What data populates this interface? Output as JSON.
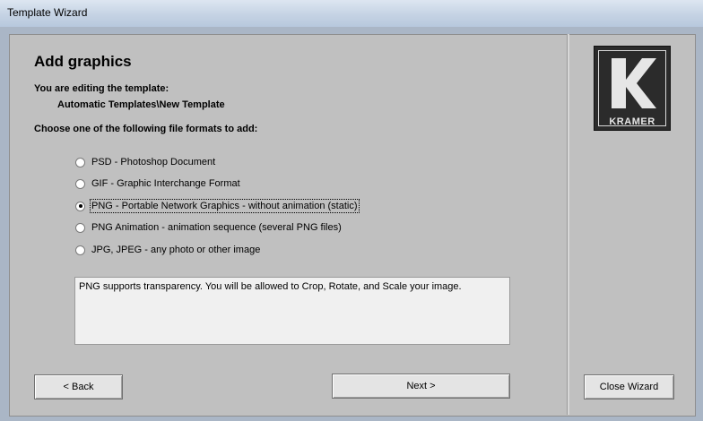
{
  "window": {
    "title": "Template Wizard"
  },
  "header": {
    "title": "Add graphics",
    "editing_label": "You are editing the template:",
    "template_path": "Automatic Templates\\New Template",
    "choose_label": "Choose one of the following file formats to add:"
  },
  "options": [
    {
      "label": "PSD - Photoshop Document",
      "selected": false
    },
    {
      "label": "GIF - Graphic Interchange Format",
      "selected": false
    },
    {
      "label": "PNG - Portable Network Graphics - without animation (static)",
      "selected": true
    },
    {
      "label": "PNG Animation - animation sequence (several PNG files)",
      "selected": false
    },
    {
      "label": "JPG, JPEG - any photo or other image",
      "selected": false
    }
  ],
  "description": "PNG supports transparency. You will be allowed to Crop, Rotate, and Scale your image.",
  "buttons": {
    "back": "< Back",
    "next": "Next >",
    "close": "Close Wizard"
  },
  "logo": {
    "text": "KRAMER"
  }
}
